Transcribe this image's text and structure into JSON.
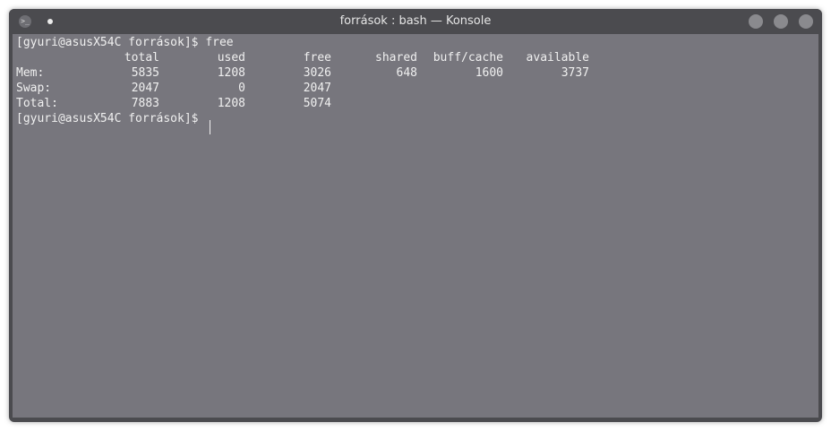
{
  "window": {
    "title": "források : bash — Konsole",
    "app_icon_glyph": ">_"
  },
  "terminal": {
    "prompt_1": "[gyuri@asusX54C források]$ free",
    "prompt_2": "[gyuri@asusX54C források]$ ",
    "headers": [
      "total",
      "used",
      "free",
      "shared",
      "buff/cache",
      "available"
    ],
    "rows": [
      {
        "label": "Mem:",
        "values": [
          "5835",
          "1208",
          "3026",
          "648",
          "1600",
          "3737"
        ]
      },
      {
        "label": "Swap:",
        "values": [
          "2047",
          "0",
          "2047",
          "",
          "",
          ""
        ]
      },
      {
        "label": "Total:",
        "values": [
          "7883",
          "1208",
          "5074",
          "",
          "",
          ""
        ]
      }
    ]
  },
  "colors": {
    "terminal_bg": "#77767d",
    "titlebar_bg": "#4b4b4f",
    "text": "#f0f0f0"
  }
}
